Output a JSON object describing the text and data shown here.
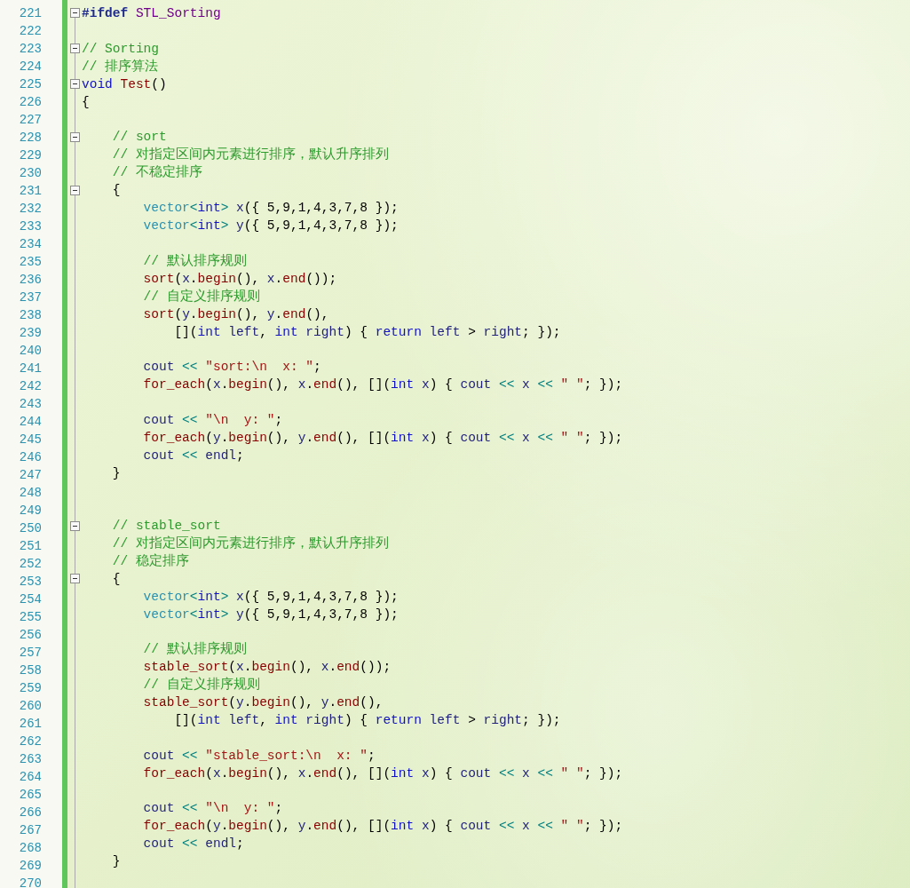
{
  "editor": {
    "lines": [
      {
        "number": "221",
        "collapsible": true,
        "tokens": [
          {
            "kind": "pp",
            "text": "#ifdef "
          },
          {
            "kind": "macro",
            "text": "STL_Sorting"
          }
        ]
      },
      {
        "number": "222",
        "collapsible": false
      },
      {
        "number": "223",
        "collapsible": true,
        "tokens": [
          {
            "kind": "cmt",
            "text": "// Sorting"
          }
        ]
      },
      {
        "number": "224",
        "collapsible": false,
        "tokens": [
          {
            "kind": "cmt",
            "text": "// 排序算法"
          }
        ]
      },
      {
        "number": "225",
        "collapsible": true,
        "tokens": [
          {
            "kind": "kw",
            "text": "void "
          },
          {
            "kind": "fn",
            "text": "Test"
          },
          {
            "kind": "p",
            "text": "()"
          }
        ]
      },
      {
        "number": "226",
        "collapsible": false,
        "tokens": [
          {
            "kind": "p",
            "text": "{"
          }
        ]
      },
      {
        "number": "227",
        "collapsible": false
      },
      {
        "number": "228",
        "collapsible": true,
        "tokens": [
          {
            "kind": "cmt",
            "text": "    // sort"
          }
        ]
      },
      {
        "number": "229",
        "collapsible": false,
        "tokens": [
          {
            "kind": "cmt",
            "text": "    // 对指定区间内元素进行排序，默认升序排列"
          }
        ]
      },
      {
        "number": "230",
        "collapsible": false,
        "tokens": [
          {
            "kind": "cmt",
            "text": "    // 不稳定排序"
          }
        ]
      },
      {
        "number": "231",
        "collapsible": true,
        "tokens": [
          {
            "kind": "p",
            "text": "    {"
          }
        ]
      },
      {
        "number": "232",
        "collapsible": false,
        "tokens": [
          {
            "kind": "type",
            "text": "        vector"
          },
          {
            "kind": "op",
            "text": "<"
          },
          {
            "kind": "kw",
            "text": "int"
          },
          {
            "kind": "op",
            "text": "> "
          },
          {
            "kind": "var",
            "text": "x"
          },
          {
            "kind": "p",
            "text": "({ 5,9,1,4,3,7,8 });"
          }
        ]
      },
      {
        "number": "233",
        "collapsible": false,
        "tokens": [
          {
            "kind": "type",
            "text": "        vector"
          },
          {
            "kind": "op",
            "text": "<"
          },
          {
            "kind": "kw",
            "text": "int"
          },
          {
            "kind": "op",
            "text": "> "
          },
          {
            "kind": "var",
            "text": "y"
          },
          {
            "kind": "p",
            "text": "({ 5,9,1,4,3,7,8 });"
          }
        ]
      },
      {
        "number": "234",
        "collapsible": false
      },
      {
        "number": "235",
        "collapsible": false,
        "tokens": [
          {
            "kind": "cmt",
            "text": "        // 默认排序规则"
          }
        ]
      },
      {
        "number": "236",
        "collapsible": false,
        "tokens": [
          {
            "kind": "fn",
            "text": "        sort"
          },
          {
            "kind": "p",
            "text": "("
          },
          {
            "kind": "var",
            "text": "x"
          },
          {
            "kind": "p",
            "text": "."
          },
          {
            "kind": "fn",
            "text": "begin"
          },
          {
            "kind": "p",
            "text": "(), "
          },
          {
            "kind": "var",
            "text": "x"
          },
          {
            "kind": "p",
            "text": "."
          },
          {
            "kind": "fn",
            "text": "end"
          },
          {
            "kind": "p",
            "text": "());"
          }
        ]
      },
      {
        "number": "237",
        "collapsible": false,
        "tokens": [
          {
            "kind": "cmt",
            "text": "        // 自定义排序规则"
          }
        ]
      },
      {
        "number": "238",
        "collapsible": false,
        "tokens": [
          {
            "kind": "fn",
            "text": "        sort"
          },
          {
            "kind": "p",
            "text": "("
          },
          {
            "kind": "var",
            "text": "y"
          },
          {
            "kind": "p",
            "text": "."
          },
          {
            "kind": "fn",
            "text": "begin"
          },
          {
            "kind": "p",
            "text": "(), "
          },
          {
            "kind": "var",
            "text": "y"
          },
          {
            "kind": "p",
            "text": "."
          },
          {
            "kind": "fn",
            "text": "end"
          },
          {
            "kind": "p",
            "text": "(),"
          }
        ]
      },
      {
        "number": "239",
        "collapsible": false,
        "tokens": [
          {
            "kind": "p",
            "text": "            []("
          },
          {
            "kind": "kw",
            "text": "int"
          },
          {
            "kind": "var",
            "text": " left"
          },
          {
            "kind": "p",
            "text": ", "
          },
          {
            "kind": "kw",
            "text": "int"
          },
          {
            "kind": "var",
            "text": " right"
          },
          {
            "kind": "p",
            "text": ") { "
          },
          {
            "kind": "kw",
            "text": "return"
          },
          {
            "kind": "var",
            "text": " left"
          },
          {
            "kind": "p",
            "text": " > "
          },
          {
            "kind": "var",
            "text": "right"
          },
          {
            "kind": "p",
            "text": "; });"
          }
        ]
      },
      {
        "number": "240",
        "collapsible": false
      },
      {
        "number": "241",
        "collapsible": false,
        "tokens": [
          {
            "kind": "var",
            "text": "        cout"
          },
          {
            "kind": "op",
            "text": " << "
          },
          {
            "kind": "str",
            "text": "\"sort:\\n  x: \""
          },
          {
            "kind": "p",
            "text": ";"
          }
        ]
      },
      {
        "number": "242",
        "collapsible": false,
        "tokens": [
          {
            "kind": "fn",
            "text": "        for_each"
          },
          {
            "kind": "p",
            "text": "("
          },
          {
            "kind": "var",
            "text": "x"
          },
          {
            "kind": "p",
            "text": "."
          },
          {
            "kind": "fn",
            "text": "begin"
          },
          {
            "kind": "p",
            "text": "(), "
          },
          {
            "kind": "var",
            "text": "x"
          },
          {
            "kind": "p",
            "text": "."
          },
          {
            "kind": "fn",
            "text": "end"
          },
          {
            "kind": "p",
            "text": "(), []("
          },
          {
            "kind": "kw",
            "text": "int"
          },
          {
            "kind": "var",
            "text": " x"
          },
          {
            "kind": "p",
            "text": ") { "
          },
          {
            "kind": "var",
            "text": "cout"
          },
          {
            "kind": "op",
            "text": " << "
          },
          {
            "kind": "var",
            "text": "x"
          },
          {
            "kind": "op",
            "text": " << "
          },
          {
            "kind": "str",
            "text": "\" \""
          },
          {
            "kind": "p",
            "text": "; });"
          }
        ]
      },
      {
        "number": "243",
        "collapsible": false
      },
      {
        "number": "244",
        "collapsible": false,
        "tokens": [
          {
            "kind": "var",
            "text": "        cout"
          },
          {
            "kind": "op",
            "text": " << "
          },
          {
            "kind": "str",
            "text": "\"\\n  y: \""
          },
          {
            "kind": "p",
            "text": ";"
          }
        ]
      },
      {
        "number": "245",
        "collapsible": false,
        "tokens": [
          {
            "kind": "fn",
            "text": "        for_each"
          },
          {
            "kind": "p",
            "text": "("
          },
          {
            "kind": "var",
            "text": "y"
          },
          {
            "kind": "p",
            "text": "."
          },
          {
            "kind": "fn",
            "text": "begin"
          },
          {
            "kind": "p",
            "text": "(), "
          },
          {
            "kind": "var",
            "text": "y"
          },
          {
            "kind": "p",
            "text": "."
          },
          {
            "kind": "fn",
            "text": "end"
          },
          {
            "kind": "p",
            "text": "(), []("
          },
          {
            "kind": "kw",
            "text": "int"
          },
          {
            "kind": "var",
            "text": " x"
          },
          {
            "kind": "p",
            "text": ") { "
          },
          {
            "kind": "var",
            "text": "cout"
          },
          {
            "kind": "op",
            "text": " << "
          },
          {
            "kind": "var",
            "text": "x"
          },
          {
            "kind": "op",
            "text": " << "
          },
          {
            "kind": "str",
            "text": "\" \""
          },
          {
            "kind": "p",
            "text": "; });"
          }
        ]
      },
      {
        "number": "246",
        "collapsible": false,
        "tokens": [
          {
            "kind": "var",
            "text": "        cout"
          },
          {
            "kind": "op",
            "text": " << "
          },
          {
            "kind": "var",
            "text": "endl"
          },
          {
            "kind": "p",
            "text": ";"
          }
        ]
      },
      {
        "number": "247",
        "collapsible": false,
        "tokens": [
          {
            "kind": "p",
            "text": "    }"
          }
        ]
      },
      {
        "number": "248",
        "collapsible": false
      },
      {
        "number": "249",
        "collapsible": false
      },
      {
        "number": "250",
        "collapsible": true,
        "tokens": [
          {
            "kind": "cmt",
            "text": "    // stable_sort"
          }
        ]
      },
      {
        "number": "251",
        "collapsible": false,
        "tokens": [
          {
            "kind": "cmt",
            "text": "    // 对指定区间内元素进行排序，默认升序排列"
          }
        ]
      },
      {
        "number": "252",
        "collapsible": false,
        "tokens": [
          {
            "kind": "cmt",
            "text": "    // 稳定排序"
          }
        ]
      },
      {
        "number": "253",
        "collapsible": true,
        "tokens": [
          {
            "kind": "p",
            "text": "    {"
          }
        ]
      },
      {
        "number": "254",
        "collapsible": false,
        "tokens": [
          {
            "kind": "type",
            "text": "        vector"
          },
          {
            "kind": "op",
            "text": "<"
          },
          {
            "kind": "kw",
            "text": "int"
          },
          {
            "kind": "op",
            "text": "> "
          },
          {
            "kind": "var",
            "text": "x"
          },
          {
            "kind": "p",
            "text": "({ 5,9,1,4,3,7,8 });"
          }
        ]
      },
      {
        "number": "255",
        "collapsible": false,
        "tokens": [
          {
            "kind": "type",
            "text": "        vector"
          },
          {
            "kind": "op",
            "text": "<"
          },
          {
            "kind": "kw",
            "text": "int"
          },
          {
            "kind": "op",
            "text": "> "
          },
          {
            "kind": "var",
            "text": "y"
          },
          {
            "kind": "p",
            "text": "({ 5,9,1,4,3,7,8 });"
          }
        ]
      },
      {
        "number": "256",
        "collapsible": false
      },
      {
        "number": "257",
        "collapsible": false,
        "tokens": [
          {
            "kind": "cmt",
            "text": "        // 默认排序规则"
          }
        ]
      },
      {
        "number": "258",
        "collapsible": false,
        "tokens": [
          {
            "kind": "fn",
            "text": "        stable_sort"
          },
          {
            "kind": "p",
            "text": "("
          },
          {
            "kind": "var",
            "text": "x"
          },
          {
            "kind": "p",
            "text": "."
          },
          {
            "kind": "fn",
            "text": "begin"
          },
          {
            "kind": "p",
            "text": "(), "
          },
          {
            "kind": "var",
            "text": "x"
          },
          {
            "kind": "p",
            "text": "."
          },
          {
            "kind": "fn",
            "text": "end"
          },
          {
            "kind": "p",
            "text": "());"
          }
        ]
      },
      {
        "number": "259",
        "collapsible": false,
        "tokens": [
          {
            "kind": "cmt",
            "text": "        // 自定义排序规则"
          }
        ]
      },
      {
        "number": "260",
        "collapsible": false,
        "tokens": [
          {
            "kind": "fn",
            "text": "        stable_sort"
          },
          {
            "kind": "p",
            "text": "("
          },
          {
            "kind": "var",
            "text": "y"
          },
          {
            "kind": "p",
            "text": "."
          },
          {
            "kind": "fn",
            "text": "begin"
          },
          {
            "kind": "p",
            "text": "(), "
          },
          {
            "kind": "var",
            "text": "y"
          },
          {
            "kind": "p",
            "text": "."
          },
          {
            "kind": "fn",
            "text": "end"
          },
          {
            "kind": "p",
            "text": "(),"
          }
        ]
      },
      {
        "number": "261",
        "collapsible": false,
        "tokens": [
          {
            "kind": "p",
            "text": "            []("
          },
          {
            "kind": "kw",
            "text": "int"
          },
          {
            "kind": "var",
            "text": " left"
          },
          {
            "kind": "p",
            "text": ", "
          },
          {
            "kind": "kw",
            "text": "int"
          },
          {
            "kind": "var",
            "text": " right"
          },
          {
            "kind": "p",
            "text": ") { "
          },
          {
            "kind": "kw",
            "text": "return"
          },
          {
            "kind": "var",
            "text": " left"
          },
          {
            "kind": "p",
            "text": " > "
          },
          {
            "kind": "var",
            "text": "right"
          },
          {
            "kind": "p",
            "text": "; });"
          }
        ]
      },
      {
        "number": "262",
        "collapsible": false
      },
      {
        "number": "263",
        "collapsible": false,
        "tokens": [
          {
            "kind": "var",
            "text": "        cout"
          },
          {
            "kind": "op",
            "text": " << "
          },
          {
            "kind": "str",
            "text": "\"stable_sort:\\n  x: \""
          },
          {
            "kind": "p",
            "text": ";"
          }
        ]
      },
      {
        "number": "264",
        "collapsible": false,
        "tokens": [
          {
            "kind": "fn",
            "text": "        for_each"
          },
          {
            "kind": "p",
            "text": "("
          },
          {
            "kind": "var",
            "text": "x"
          },
          {
            "kind": "p",
            "text": "."
          },
          {
            "kind": "fn",
            "text": "begin"
          },
          {
            "kind": "p",
            "text": "(), "
          },
          {
            "kind": "var",
            "text": "x"
          },
          {
            "kind": "p",
            "text": "."
          },
          {
            "kind": "fn",
            "text": "end"
          },
          {
            "kind": "p",
            "text": "(), []("
          },
          {
            "kind": "kw",
            "text": "int"
          },
          {
            "kind": "var",
            "text": " x"
          },
          {
            "kind": "p",
            "text": ") { "
          },
          {
            "kind": "var",
            "text": "cout"
          },
          {
            "kind": "op",
            "text": " << "
          },
          {
            "kind": "var",
            "text": "x"
          },
          {
            "kind": "op",
            "text": " << "
          },
          {
            "kind": "str",
            "text": "\" \""
          },
          {
            "kind": "p",
            "text": "; });"
          }
        ]
      },
      {
        "number": "265",
        "collapsible": false
      },
      {
        "number": "266",
        "collapsible": false,
        "tokens": [
          {
            "kind": "var",
            "text": "        cout"
          },
          {
            "kind": "op",
            "text": " << "
          },
          {
            "kind": "str",
            "text": "\"\\n  y: \""
          },
          {
            "kind": "p",
            "text": ";"
          }
        ]
      },
      {
        "number": "267",
        "collapsible": false,
        "tokens": [
          {
            "kind": "fn",
            "text": "        for_each"
          },
          {
            "kind": "p",
            "text": "("
          },
          {
            "kind": "var",
            "text": "y"
          },
          {
            "kind": "p",
            "text": "."
          },
          {
            "kind": "fn",
            "text": "begin"
          },
          {
            "kind": "p",
            "text": "(), "
          },
          {
            "kind": "var",
            "text": "y"
          },
          {
            "kind": "p",
            "text": "."
          },
          {
            "kind": "fn",
            "text": "end"
          },
          {
            "kind": "p",
            "text": "(), []("
          },
          {
            "kind": "kw",
            "text": "int"
          },
          {
            "kind": "var",
            "text": " x"
          },
          {
            "kind": "p",
            "text": ") { "
          },
          {
            "kind": "var",
            "text": "cout"
          },
          {
            "kind": "op",
            "text": " << "
          },
          {
            "kind": "var",
            "text": "x"
          },
          {
            "kind": "op",
            "text": " << "
          },
          {
            "kind": "str",
            "text": "\" \""
          },
          {
            "kind": "p",
            "text": "; });"
          }
        ]
      },
      {
        "number": "268",
        "collapsible": false,
        "tokens": [
          {
            "kind": "var",
            "text": "        cout"
          },
          {
            "kind": "op",
            "text": " << "
          },
          {
            "kind": "var",
            "text": "endl"
          },
          {
            "kind": "p",
            "text": ";"
          }
        ]
      },
      {
        "number": "269",
        "collapsible": false,
        "tokens": [
          {
            "kind": "p",
            "text": "    }"
          }
        ]
      },
      {
        "number": "270",
        "collapsible": false
      }
    ]
  }
}
